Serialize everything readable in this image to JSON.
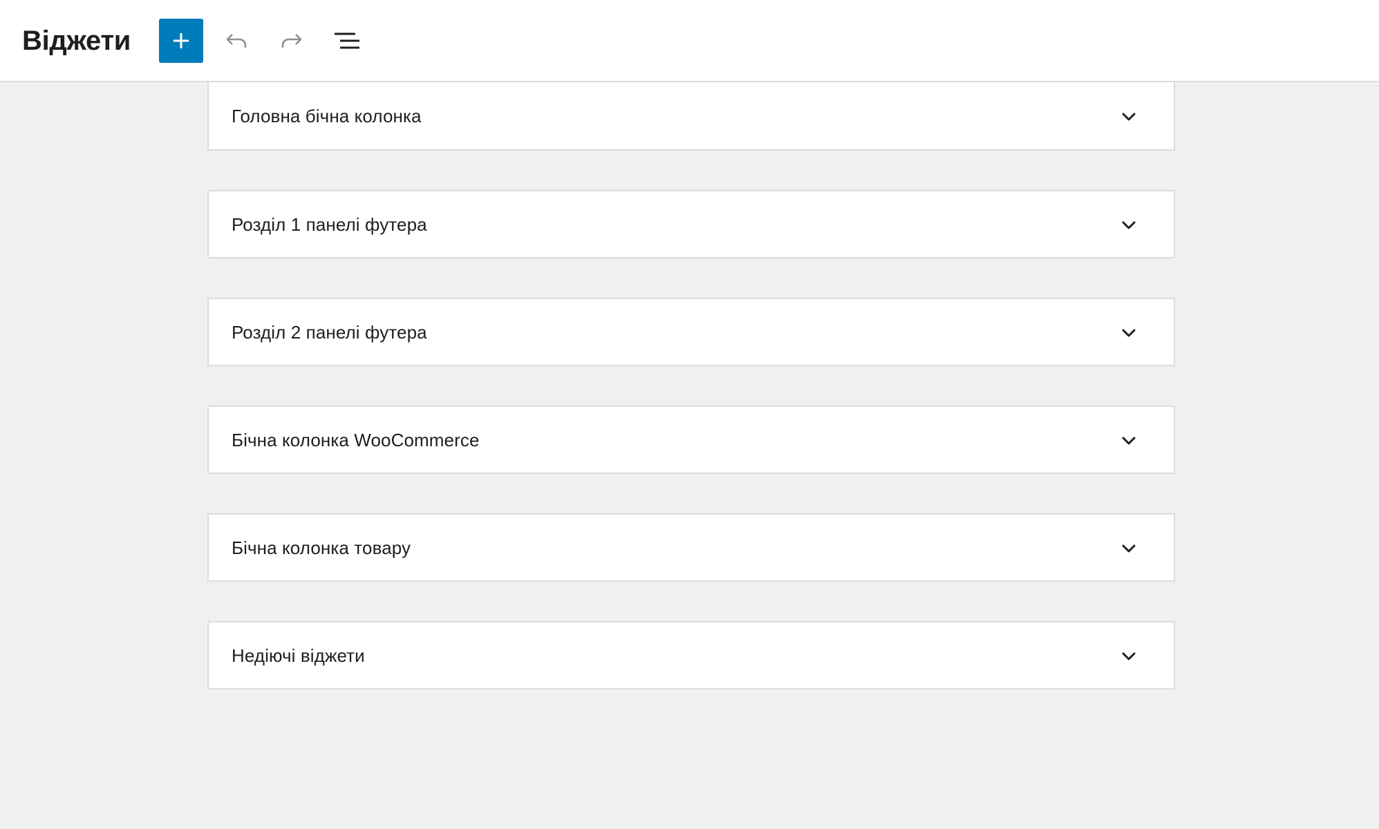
{
  "header": {
    "title": "Віджети",
    "add_icon": "plus-icon",
    "undo_icon": "undo-icon",
    "redo_icon": "redo-icon",
    "list_view_icon": "list-view-icon",
    "accent_color": "#007cba"
  },
  "widget_areas": [
    {
      "label": "Головна бічна колонка",
      "icon": "chevron-down-icon"
    },
    {
      "label": "Розділ 1 панелі футера",
      "icon": "chevron-down-icon"
    },
    {
      "label": "Розділ 2 панелі футера",
      "icon": "chevron-down-icon"
    },
    {
      "label": "Бічна колонка WooCommerce",
      "icon": "chevron-down-icon"
    },
    {
      "label": "Бічна колонка товару",
      "icon": "chevron-down-icon"
    },
    {
      "label": "Недіючі віджети",
      "icon": "chevron-down-icon"
    }
  ]
}
